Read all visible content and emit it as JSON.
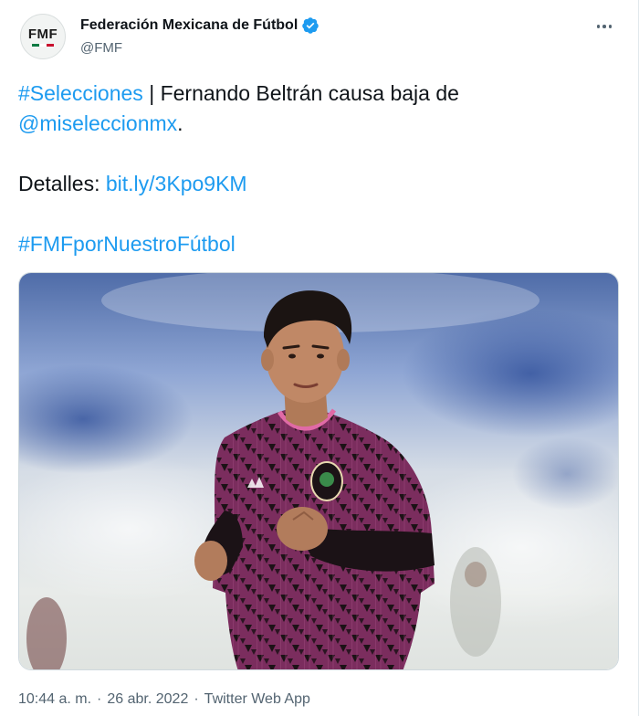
{
  "author": {
    "display_name": "Federación Mexicana de Fútbol",
    "handle": "@FMF",
    "avatar_text": "FMF",
    "verified_icon": "verified-badge",
    "verified_color": "#1d9bf0"
  },
  "menu": {
    "icon": "more-horizontal"
  },
  "tweet": {
    "line1_hashtag": "#Selecciones",
    "line1_text": " | Fernando Beltrán causa baja de",
    "line2_mention": "@miseleccionmx",
    "line2_text": ".",
    "line3_text": "Detalles: ",
    "line3_link": "bit.ly/3Kpo9KM",
    "line4_hashtag": "#FMFporNuestroFútbol"
  },
  "media": {
    "alt": "",
    "subject": "soccer-player-photo"
  },
  "meta": {
    "time": "10:44 a. m.",
    "separator": "·",
    "date": "26 abr. 2022",
    "source": "Twitter Web App"
  },
  "colors": {
    "link": "#1d9bf0",
    "text": "#0f1419",
    "secondary": "#536471",
    "jersey": "#7a2a5a"
  }
}
